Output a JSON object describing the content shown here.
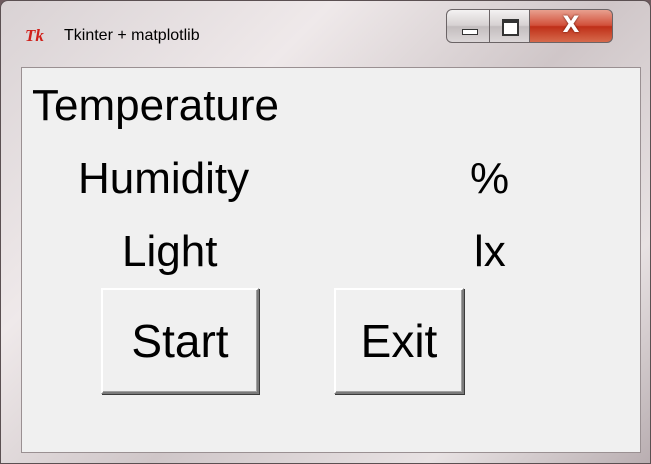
{
  "window": {
    "title": "Tkinter + matplotlib",
    "app_icon": "Tk",
    "close_glyph": "X"
  },
  "labels": {
    "temperature": "Temperature",
    "humidity": "Humidity",
    "humidity_unit": "%",
    "light": "Light",
    "light_unit": "lx"
  },
  "buttons": {
    "start": "Start",
    "exit": "Exit"
  }
}
